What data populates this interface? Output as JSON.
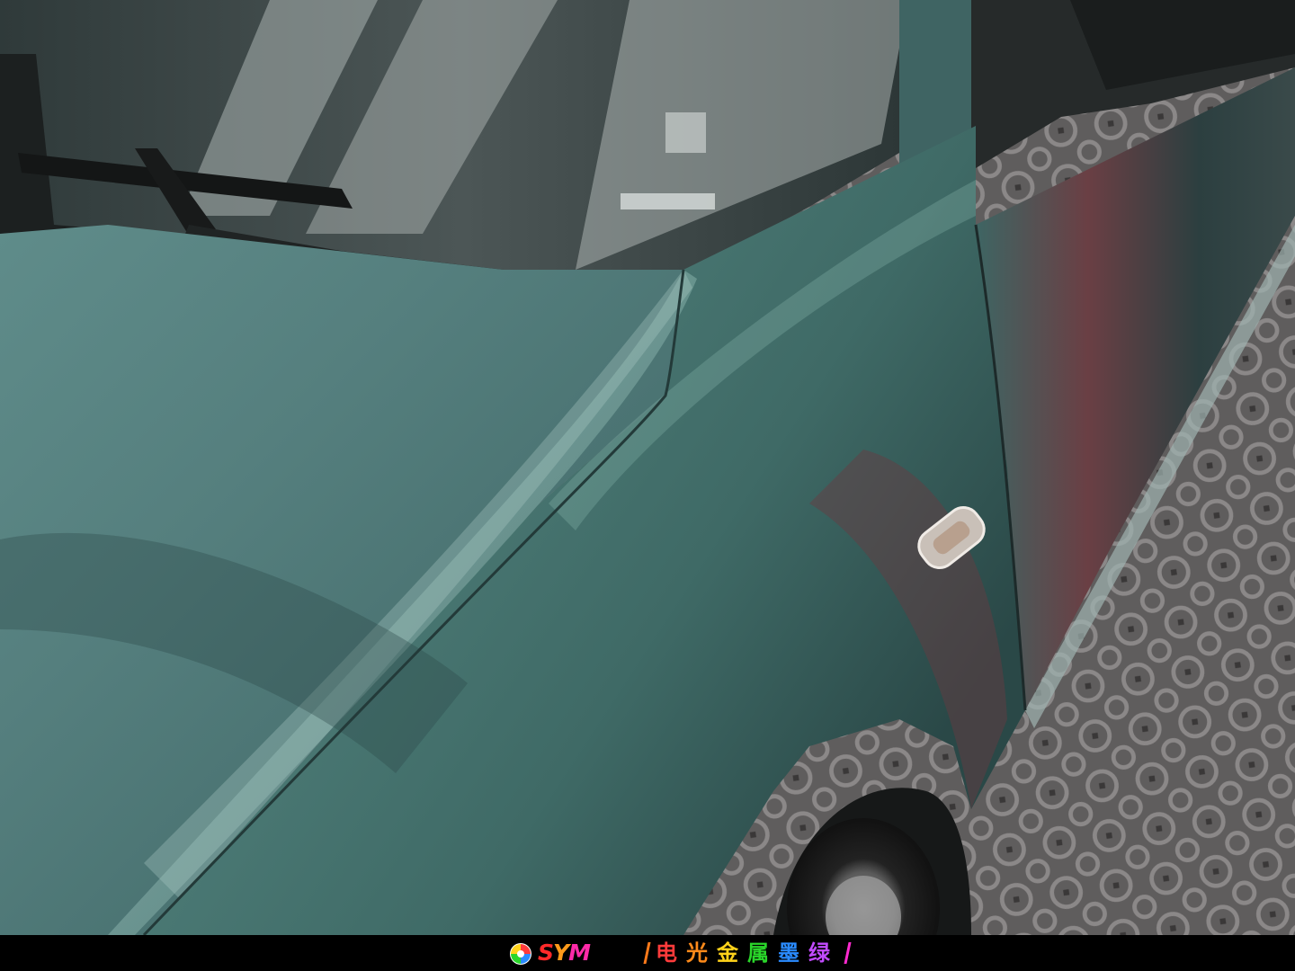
{
  "brand": {
    "wordmark": "SYM",
    "logo_icon": "swirl-logo-icon",
    "wordmark_colors": [
      "#ff2a2a",
      "#ff9a1a",
      "#ff2aa8"
    ]
  },
  "caption": {
    "text": "电光金属墨绿",
    "char_colors": [
      "#ff3b3b",
      "#ff8a1a",
      "#ffd21a",
      "#2ad62a",
      "#2a8bff",
      "#c24bff"
    ],
    "divider_colors": [
      "#ff7a1a",
      "#ff2ad0"
    ]
  },
  "photo": {
    "subject_icons": [
      "windshield",
      "wiper-arm",
      "hood",
      "front-fender",
      "side-mirror",
      "side-marker-lamp",
      "front-tire",
      "floor-tiles"
    ],
    "colors": {
      "wrap_teal": "#4f7f7c",
      "wrap_highlight": "#8fbab4",
      "wrap_shadow": "#1f3a3a",
      "reflection_red": "#7a3a3a",
      "floor": "#6e6c6c",
      "glass": "#3a4444"
    }
  }
}
